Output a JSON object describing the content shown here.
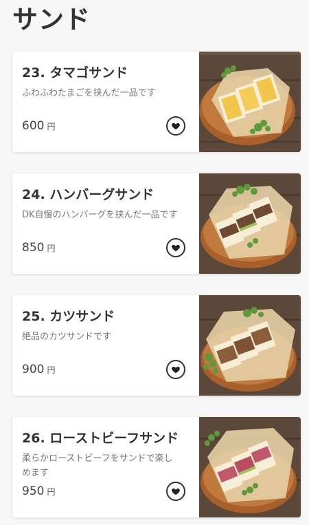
{
  "page": {
    "title": "サンド"
  },
  "items": [
    {
      "name": "23. タマゴサンド",
      "description": "ふわふわたまごを挟んだ一品です",
      "price": "600",
      "unit": "円",
      "photo_icon": "egg-sandwich-photo"
    },
    {
      "name": "24. ハンバーグサンド",
      "description": "DK自慢のハンバーグを挟んだ一品です",
      "price": "850",
      "unit": "円",
      "photo_icon": "hamburg-sandwich-photo"
    },
    {
      "name": "25. カツサンド",
      "description": "絶品のカツサンドです",
      "price": "900",
      "unit": "円",
      "photo_icon": "katsu-sandwich-photo"
    },
    {
      "name": "26. ローストビーフサンド",
      "description": "柔らかローストビーフをサンドで楽しめます",
      "price": "950",
      "unit": "円",
      "photo_icon": "roast-beef-sandwich-photo"
    }
  ],
  "colors": {
    "background": "#f7f7f7",
    "card": "#ffffff",
    "text": "#333333",
    "muted_text": "#777777",
    "wood": "#5a4636",
    "board": "#b46a32"
  }
}
